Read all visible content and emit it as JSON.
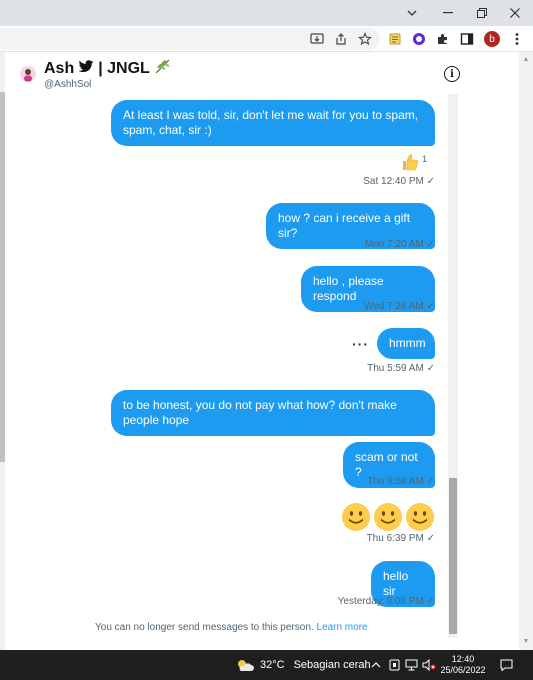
{
  "conversation": {
    "name": "Ash",
    "name_suffix": "| JNGL",
    "handle": "@AshhSol"
  },
  "messages": [
    {
      "text": "At least I was told, sir, don't let me wait for you to spam, spam, chat, sir :)",
      "time": "Sat 12:40 PM",
      "reaction": "thumbs-up",
      "reaction_count": "1"
    },
    {
      "text": "how ? can i receive a gift sir?",
      "time": "Mon 7:20 AM"
    },
    {
      "text": "hello , please respond",
      "time": "Wed 7:26 AM"
    },
    {
      "text": "hmmm",
      "time": "Thu 5:59 AM"
    },
    {
      "text": "to be honest, you do not pay what how? don't make people hope",
      "time": ""
    },
    {
      "text": "scam or not ?",
      "time": "Thu 9:58 AM"
    },
    {
      "text": "",
      "emoji": [
        "slightly-smiling-face",
        "slightly-smiling-face",
        "slightly-smiling-face"
      ],
      "time": "Thu 6:39 PM"
    },
    {
      "text": "hello sir",
      "time": "Yesterday, 9:06 PM"
    }
  ],
  "footer": {
    "notice": "You can no longer send messages to this person.",
    "link": "Learn more"
  },
  "taskbar": {
    "weather_temp": "32°C",
    "weather_text": "Sebagian cerah",
    "time": "12:40",
    "date": "25/06/2022"
  },
  "browser": {
    "profile_letter": "b"
  },
  "colors": {
    "bubble": "#1d9bf0",
    "text_secondary": "#536471",
    "taskbar": "#1f1f1f"
  }
}
